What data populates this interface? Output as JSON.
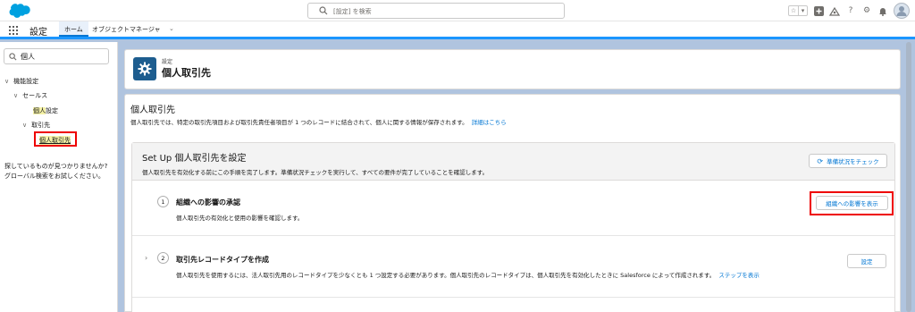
{
  "header": {
    "search_placeholder": "[設定] を検索"
  },
  "app_nav": {
    "app_name": "設定",
    "tabs": [
      {
        "label": "ホーム",
        "active": true
      },
      {
        "label": "オブジェクトマネージャ",
        "active": false
      }
    ]
  },
  "sidebar": {
    "quick_find_value": "個人",
    "tree": {
      "section": "機能設定",
      "group": "セールス",
      "item_settings_highlight": "個人",
      "item_settings_rest": "設定",
      "subgroup": "取引先",
      "selected_item": "個人取引先"
    },
    "help_line1": "探しているものが見つかりませんか?",
    "help_line2": "グローバル検索をお試しください。"
  },
  "setup_header": {
    "label": "設定",
    "title": "個人取引先"
  },
  "main": {
    "title": "個人取引先",
    "description": "個人取引先では、特定の取引先項目および取引先責任者項目が 1 つのレコードに結合されて、個人に関する情報が保存されます。",
    "details_link": "詳細はこちら",
    "setup_section": {
      "title": "Set Up 個人取引先を設定",
      "description": "個人取引先を有効化する前にこの手順を完了します。準備状況チェックを実行して、すべての要件が完了していることを確認します。",
      "check_button": "準備状況をチェック",
      "steps": [
        {
          "number": "1",
          "title": "組織への影響の承認",
          "description": "個人取引先の有効化と使用の影響を確認します。",
          "button": "組織への影響を表示"
        },
        {
          "number": "2",
          "title": "取引先レコードタイプを作成",
          "description": "個人取引先を使用するには、法人取引先用のレコードタイプを少なくとも 1 つ設定する必要があります。個人取引先のレコードタイプは、個人取引先を有効化したときに Salesforce によって作成されます。",
          "link": "ステップを表示",
          "button": "設定"
        }
      ]
    }
  },
  "colors": {
    "brand_blue": "#0176d3",
    "salesforce_cloud": "#00a1e0",
    "setup_icon_bg": "#1d5d8f",
    "highlight_box": "#ee0000",
    "background": "#b0c4df"
  }
}
